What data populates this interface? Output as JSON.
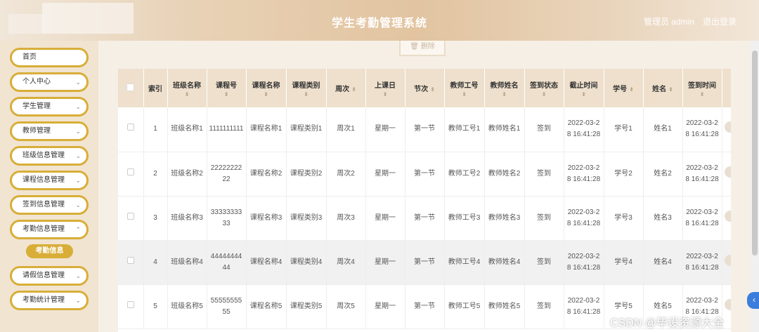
{
  "header": {
    "title": "学生考勤管理系统",
    "user": "管理员 admin",
    "logout": "退出登录"
  },
  "sidebar": {
    "items": [
      {
        "label": "首页",
        "chevron": ""
      },
      {
        "label": "个人中心",
        "chevron": "⌄"
      },
      {
        "label": "学生管理",
        "chevron": "⌄"
      },
      {
        "label": "教师管理",
        "chevron": "⌄"
      },
      {
        "label": "班级信息管理",
        "chevron": "⌄"
      },
      {
        "label": "课程信息管理",
        "chevron": "⌄"
      },
      {
        "label": "签到信息管理",
        "chevron": "⌄"
      },
      {
        "label": "考勤信息管理",
        "chevron": "⌃"
      },
      {
        "label": "请假信息管理",
        "chevron": "⌄"
      },
      {
        "label": "考勤统计管理",
        "chevron": "⌄"
      }
    ],
    "active_submenu": "考勤信息"
  },
  "toolbar": {
    "delete_label": "删除",
    "delete_icon": "trash-icon"
  },
  "table": {
    "headers": [
      "索引",
      "班级名称",
      "课程号",
      "课程名称",
      "课程类别",
      "周次",
      "上课日",
      "节次",
      "教师工号",
      "教师姓名",
      "签到状态",
      "截止时间",
      "学号",
      "姓名",
      "签到时间"
    ],
    "rows": [
      [
        "1",
        "班级名称1",
        "1111111111",
        "课程名称1",
        "课程类别1",
        "周次1",
        "星期一",
        "第一节",
        "教师工号1",
        "教师姓名1",
        "签到",
        "2022-03-28 16:41:28",
        "学号1",
        "姓名1",
        "2022-03-28 16:41:28"
      ],
      [
        "2",
        "班级名称2",
        "2222222222",
        "课程名称2",
        "课程类别2",
        "周次2",
        "星期一",
        "第一节",
        "教师工号2",
        "教师姓名2",
        "签到",
        "2022-03-28 16:41:28",
        "学号2",
        "姓名2",
        "2022-03-28 16:41:28"
      ],
      [
        "3",
        "班级名称3",
        "3333333333",
        "课程名称3",
        "课程类别3",
        "周次3",
        "星期一",
        "第一节",
        "教师工号3",
        "教师姓名3",
        "签到",
        "2022-03-28 16:41:28",
        "学号3",
        "姓名3",
        "2022-03-28 16:41:28"
      ],
      [
        "4",
        "班级名称4",
        "4444444444",
        "课程名称4",
        "课程类别4",
        "周次4",
        "星期一",
        "第一节",
        "教师工号4",
        "教师姓名4",
        "签到",
        "2022-03-28 16:41:28",
        "学号4",
        "姓名4",
        "2022-03-28 16:41:28"
      ],
      [
        "5",
        "班级名称5",
        "5555555555",
        "课程名称5",
        "课程类别5",
        "周次5",
        "星期一",
        "第一节",
        "教师工号5",
        "教师姓名5",
        "签到",
        "2022-03-28 16:41:28",
        "学号5",
        "姓名5",
        "2022-03-28 16:41:28"
      ]
    ]
  },
  "watermark": "CSDN @毕设资源大全",
  "colors": {
    "accent": "#d8ae38",
    "header_bg": "#e2c4a0",
    "table_head_bg": "#eee0cc",
    "side_tab": "#3b7ddd"
  }
}
